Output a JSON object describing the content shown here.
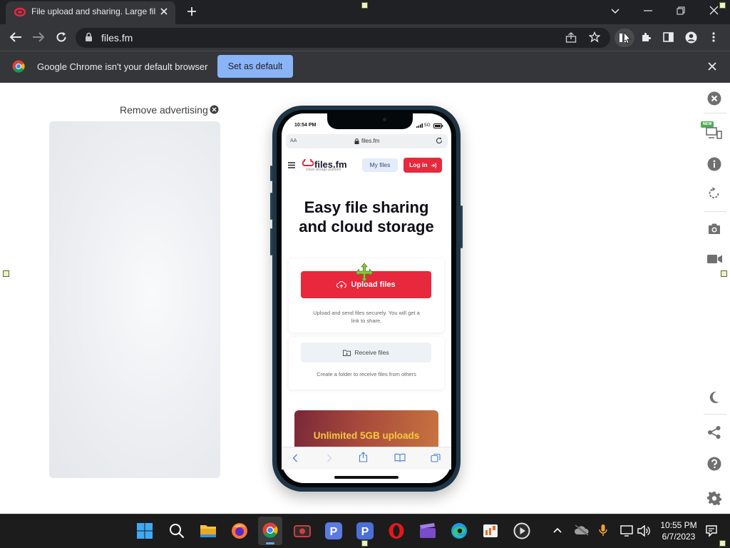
{
  "browser": {
    "tab_title": "File upload and sharing. Large fil",
    "url": "files.fm",
    "infobar_text": "Google Chrome isn't your default browser",
    "set_default_label": "Set as default"
  },
  "page": {
    "remove_ad_label": "Remove advertising"
  },
  "phone": {
    "time": "10:54 PM",
    "status": "5G",
    "address_aa": "AA",
    "address_url": "files.fm",
    "logo": "files.fm",
    "logo_sub": "cloud storage platform",
    "my_files": "My files",
    "login": "Log in",
    "headline_line1": "Easy file sharing",
    "headline_line2": "and cloud storage",
    "upload_button": "Upload files",
    "upload_desc": "Upload and send files securely. You will get a link to share.",
    "receive_button": "Receive files",
    "receive_desc": "Create a folder to receive files from others",
    "banner_text": "Unlimited 5GB uploads"
  },
  "sidebar": {
    "new_badge": "NEW"
  },
  "taskbar": {
    "time": "10:55 PM",
    "date": "6/7/2023"
  },
  "colors": {
    "accent_red": "#e8283c",
    "chrome_dark": "#202124",
    "chrome_mid": "#35363a",
    "chrome_blue": "#8ab4f8"
  }
}
